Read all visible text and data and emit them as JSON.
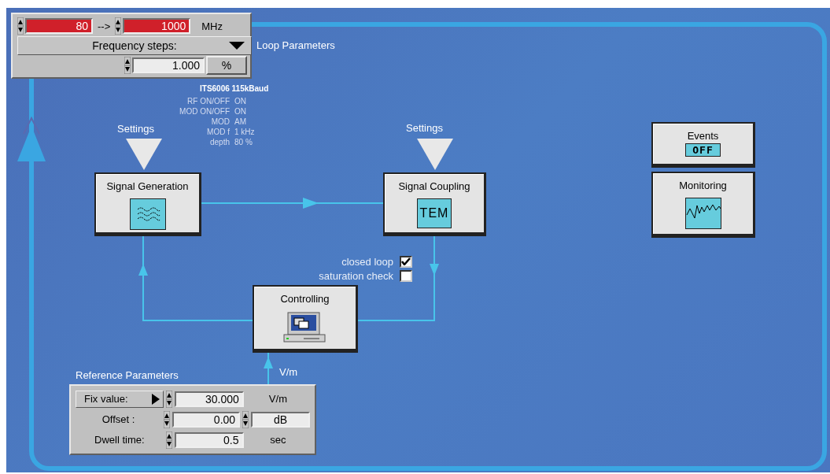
{
  "loop_parameters": {
    "title": "Loop Parameters",
    "start": "80",
    "arrow": "-->",
    "stop": "1000",
    "unit": "MHz",
    "mode": "Frequency steps:",
    "step": "1.000",
    "step_unit": "%"
  },
  "generator_info": {
    "header": "ITS6006 115kBaud",
    "rows": [
      {
        "label": "RF ON/OFF",
        "value": "ON"
      },
      {
        "label": "MOD ON/OFF",
        "value": "ON"
      },
      {
        "label": "MOD",
        "value": "AM"
      },
      {
        "label": "MOD f",
        "value": "1 kHz"
      },
      {
        "label": "depth",
        "value": "80 %"
      }
    ]
  },
  "nodes": [
    {
      "kind": "generation",
      "title": "Signal Generation",
      "settings_label": "Settings"
    },
    {
      "kind": "coupling",
      "title": "Signal Coupling",
      "settings_label": "Settings",
      "icon_text": "TEM"
    },
    {
      "kind": "events",
      "title": "Events",
      "indicator": "OFF"
    },
    {
      "kind": "monitoring",
      "title": "Monitoring"
    },
    {
      "kind": "controlling",
      "title": "Controlling"
    }
  ],
  "options": [
    {
      "label": "closed loop",
      "checked": true
    },
    {
      "label": "saturation check",
      "checked": false
    }
  ],
  "feedback_unit": "V/m",
  "reference_parameters": {
    "title": "Reference Parameters",
    "rows": [
      {
        "kind": "dropdown",
        "label": "Fix value:",
        "value": "30.000",
        "unit": "V/m"
      },
      {
        "kind": "spin_unit",
        "label": "Offset :",
        "value": "0.00",
        "unit": "dB"
      },
      {
        "kind": "plain",
        "label": "Dwell time:",
        "value": "0.5",
        "unit": "sec"
      }
    ]
  }
}
